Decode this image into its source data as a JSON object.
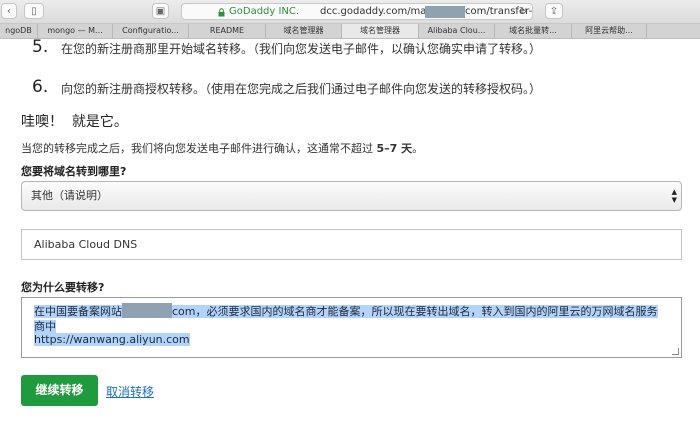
{
  "browser": {
    "secure_label": "GoDaddy INC.",
    "url_prefix": "dcc.godaddy.com/manage/",
    "url_suffix": "com/transfer-out",
    "tabs": [
      {
        "label": "ngoDB"
      },
      {
        "label": "mongo — M..."
      },
      {
        "label": "Configuratio..."
      },
      {
        "label": "README"
      },
      {
        "label": "域名管理器"
      },
      {
        "label": "域名管理器"
      },
      {
        "label": "Alibaba Clou..."
      },
      {
        "label": "域名批量转..."
      },
      {
        "label": "阿里云帮助..."
      }
    ],
    "active_tab": 5
  },
  "steps": [
    {
      "num": "5.",
      "text": "在您的新注册商那里开始域名转移。（我们向您发送电子邮件，以确认您确实申请了转移。）"
    },
    {
      "num": "6.",
      "text": "向您的新注册商授权转移。（使用在您完成之后我们通过电子邮件向您发送的转移授权码。）"
    }
  ],
  "heading": "哇噢！  就是它。",
  "info_before": "当您的转移完成之后，我们将向您发送电子邮件进行确认，这通常不超过 ",
  "info_days": "5–7 天",
  "info_after": "。",
  "destination": {
    "label": "您要将域名转到哪里?",
    "selected": "其他（请说明）",
    "other_value": "Alibaba Cloud DNS"
  },
  "reason": {
    "label": "您为什么要转移?",
    "line1_before": "在中国要备案网站",
    "line1_after": "com，必须要求国内的域名商才能备案，所以现在要转出域名，转入到国内的阿里云的万网域名服务",
    "line2": "商中",
    "line3": "https://wanwang.aliyun.com"
  },
  "actions": {
    "continue_label": "继续转移",
    "cancel_label": "取消转移"
  },
  "colors": {
    "primary": "#1f9a3c",
    "link": "#1e6fbf",
    "selection": "#b4d3fa"
  }
}
